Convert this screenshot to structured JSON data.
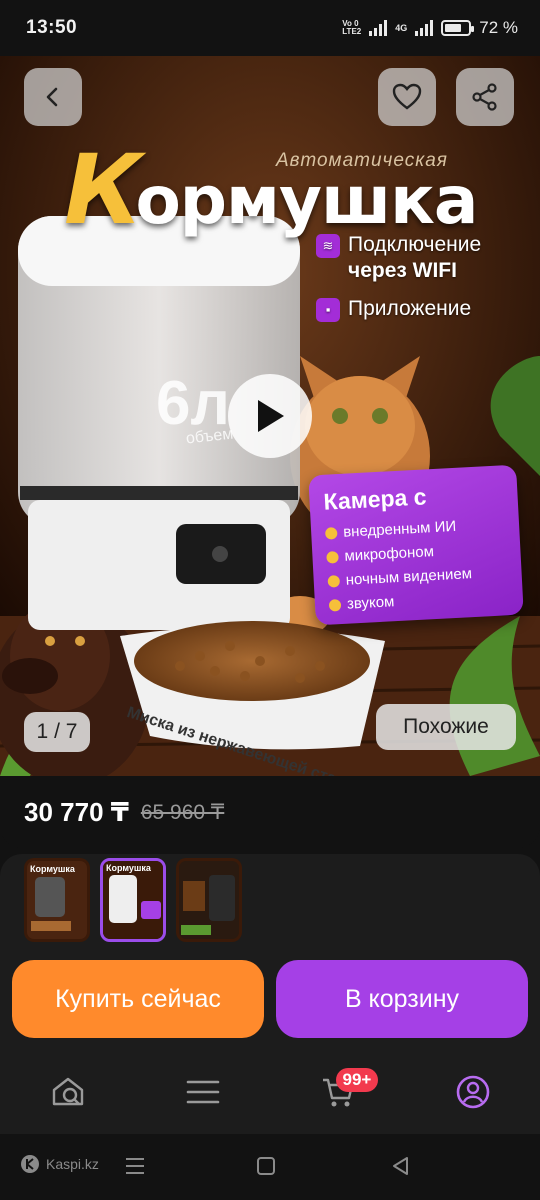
{
  "status": {
    "time": "13:50",
    "net_top": "Vo 0",
    "net_bottom": "LTE2",
    "net2": "4G",
    "battery": "72 %",
    "battery_level": 0.72
  },
  "hero": {
    "brand_small": "Автоматическая",
    "brand_big_first": "К",
    "brand_big_rest": "ормушка",
    "feature_1_line1": "Подключение",
    "feature_1_line2": "через WIFI",
    "feature_2": "Приложение",
    "volume": "6л",
    "volume_sub": "объем",
    "camera_title": "Камера с",
    "camera_items": [
      "внедренным ИИ",
      "микрофоном",
      "ночным видением",
      "звуком"
    ],
    "bowl_caption": "Миска из нержавеющей стали",
    "counter_current": "1",
    "counter_sep": "/",
    "counter_total": "7",
    "similar_label": "Похожие"
  },
  "price": {
    "current": "30 770 ₸",
    "old": "65 960 ₸"
  },
  "thumbs": {
    "count": 3,
    "active_index": 1
  },
  "actions": {
    "buy_now": "Купить сейчас",
    "add_to_cart": "В корзину"
  },
  "nav": {
    "cart_badge": "99+"
  },
  "system": {
    "brand": "Kaspi.kz"
  },
  "colors": {
    "accent_purple": "#a540e6",
    "accent_orange": "#ff8a2c",
    "badge_red": "#f23a4e"
  }
}
